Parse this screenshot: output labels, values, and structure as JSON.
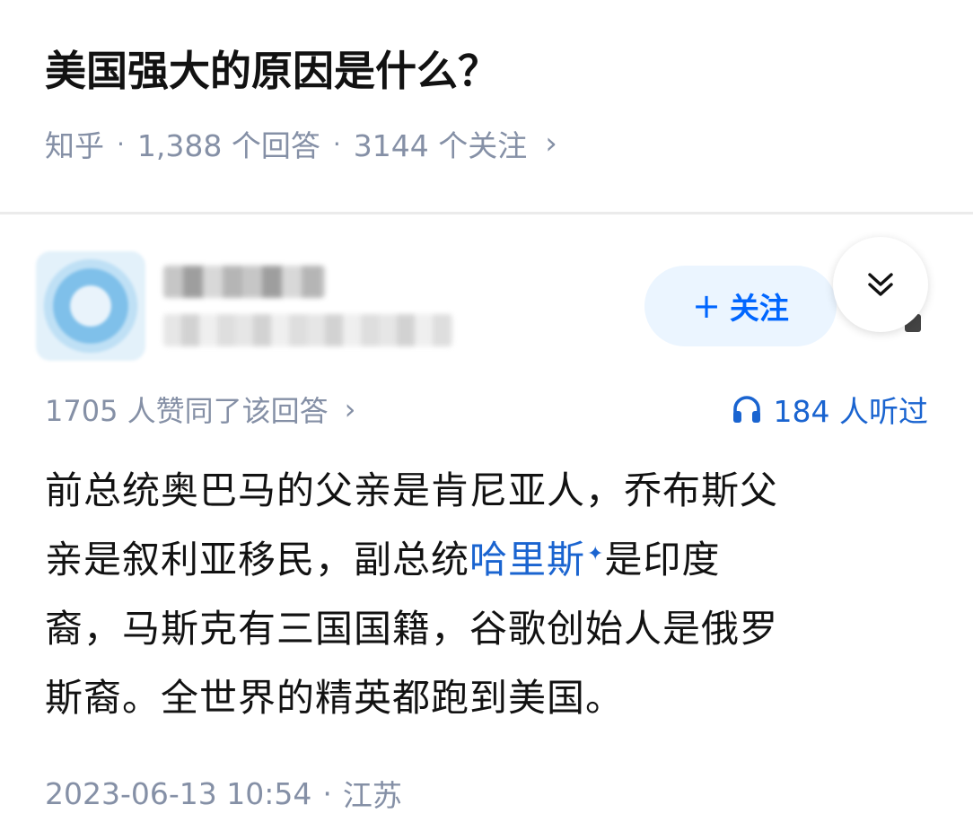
{
  "question": {
    "title": "美国强大的原因是什么？",
    "source": "知乎",
    "separator": "·",
    "answers_count": "1,388 个回答",
    "followers_count": "3144 个关注",
    "chevron": "›"
  },
  "author": {
    "avatar_icon": "avatar-icon",
    "name": "",
    "bio": "",
    "follow_plus": "+",
    "follow_label": "关注",
    "collapse_icon": "chevron-double-down-icon"
  },
  "stats": {
    "votes_text": "1705 人赞同了该回答",
    "chevron": "›",
    "listen_icon": "headphones-icon",
    "listen_text": "184 人听过"
  },
  "answer": {
    "line1": "前总统奥巴马的父亲是肯尼亚人，乔布斯父",
    "line2_a": "亲是叙利亚移民，副总统",
    "line2_link": "哈里斯",
    "line2_star": "✦",
    "line2_b": "是印度",
    "line3": "裔，马斯克有三国国籍，谷歌创始人是俄罗",
    "line4": "斯裔。全世界的精英都跑到美国。"
  },
  "footer": {
    "datetime": "2023-06-13 10:54",
    "separator": "·",
    "location": "江苏"
  },
  "colors": {
    "accent_blue": "#1a64d0",
    "follow_bg": "#ebf5ff",
    "follow_text": "#0066ff",
    "meta_grey": "#8590a6",
    "text": "#121212"
  }
}
